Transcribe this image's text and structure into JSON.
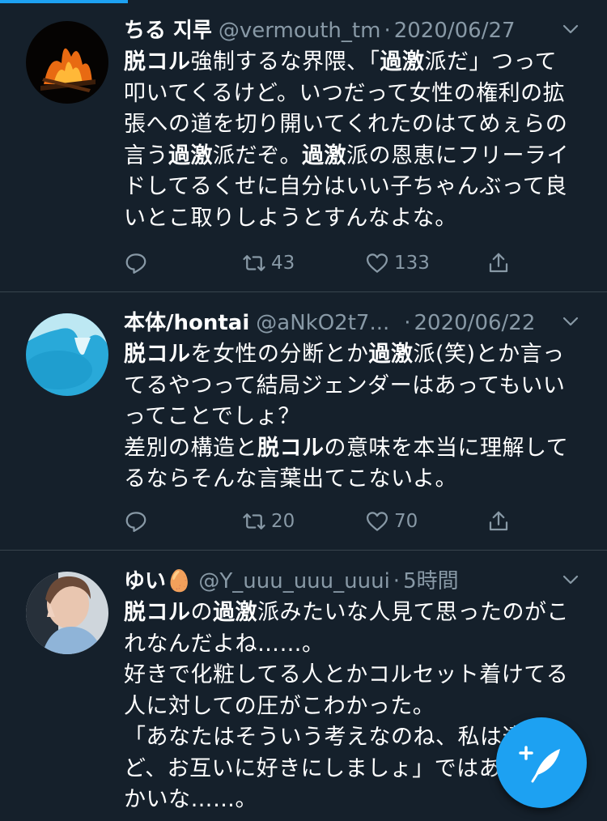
{
  "tweets": [
    {
      "name": "ちる 지루",
      "handle": "@vermouth_tm",
      "sep": "·",
      "time": "2020/06/27",
      "body": [
        [
          {
            "t": "脱コル",
            "b": true
          },
          {
            "t": "強制するな界隈、「"
          },
          {
            "t": "過激",
            "b": true
          },
          {
            "t": "派だ」つって\n叩いてくるけど。いつだって女性の権利の拡\n張への道を切り開いてくれたのはてめぇらの\n言う"
          },
          {
            "t": "過激",
            "b": true
          },
          {
            "t": "派だぞ。"
          },
          {
            "t": "過激",
            "b": true
          },
          {
            "t": "派の恩恵にフリーライ\nドしてるくせに自分はいい子ちゃんぶって良\nいとこ取りしようとすんなよな。"
          }
        ]
      ],
      "retweets": "43",
      "likes": "133"
    },
    {
      "name": "本体/hontai",
      "handle": "@aNkO2t7...",
      "sep": "·",
      "time": "2020/06/22",
      "body": [
        [
          {
            "t": "脱コル",
            "b": true
          },
          {
            "t": "を女性の分断とか"
          },
          {
            "t": "過激",
            "b": true
          },
          {
            "t": "派(笑)とか言っ\nてるやつって結局ジェンダーはあってもいい\nってことでしょ？\n差別の構造と"
          },
          {
            "t": "脱コル",
            "b": true
          },
          {
            "t": "の意味を本当に理解して\nるならそんな言葉出てこないよ。"
          }
        ]
      ],
      "retweets": "20",
      "likes": "70"
    },
    {
      "name": "ゆい🥚",
      "handle": "@Y_uuu_uuu_uuui",
      "sep": "·",
      "time": "5時間",
      "body": [
        [
          {
            "t": "脱コル",
            "b": true
          },
          {
            "t": "の"
          },
          {
            "t": "過激",
            "b": true
          },
          {
            "t": "派みたいな人見て思ったのがこ\nれなんだよね……。\n好きで化粧してる人とかコルセット着けてる\n人に対しての圧がこわかった。\n「あなたはそういう考えなのね、私は違うけ\nど、お互いに好きにしましょ」ではあかんの\nかいな……。"
          }
        ]
      ]
    }
  ],
  "compose_button": "compose-tweet",
  "colors": {
    "accent": "#1da1f2",
    "background": "#15202b",
    "muted": "#8899a6",
    "divider": "#38444d"
  }
}
